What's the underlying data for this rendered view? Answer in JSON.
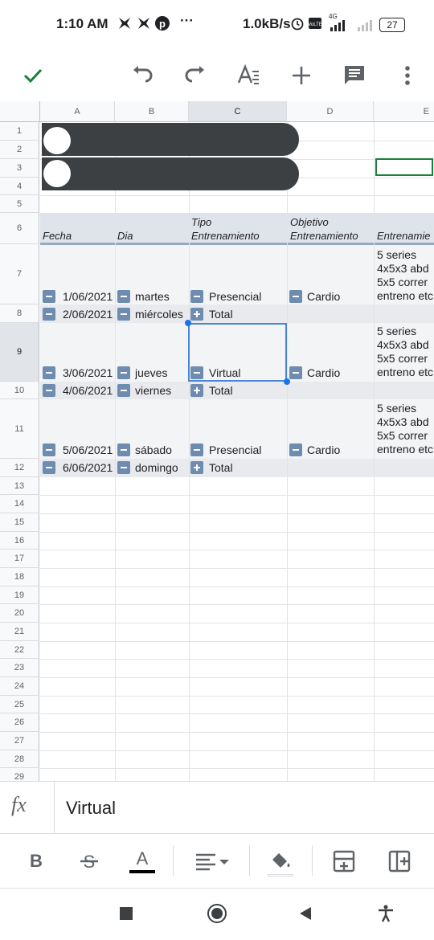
{
  "status_bar": {
    "time": "1:10 AM",
    "more": "···",
    "speed": "1.0kB/s",
    "network": "4G",
    "battery": "27"
  },
  "toolbar": {
    "icons": [
      "check-icon",
      "undo-icon",
      "redo-icon",
      "text-format-icon",
      "add-icon",
      "comment-icon",
      "more-vert-icon"
    ],
    "accent": "#188038"
  },
  "grid": {
    "columns": [
      "A",
      "B",
      "C",
      "D",
      "E"
    ],
    "selected_column": "C",
    "rows": [
      "1",
      "2",
      "3",
      "4",
      "5",
      "6",
      "7",
      "8",
      "9",
      "10",
      "11",
      "12",
      "13",
      "14",
      "15",
      "16",
      "17",
      "18",
      "19",
      "20",
      "21",
      "22",
      "23",
      "24",
      "25",
      "26",
      "27",
      "28",
      "29"
    ],
    "selected_row": "9",
    "headers": {
      "fecha": "Fecha",
      "dia": "Dia",
      "tipo_1": "Tipo",
      "tipo_2": "Entrenamiento",
      "objetivo_1": "Objetivo",
      "objetivo_2": "Entrenamiento",
      "entrenamiento": "Entrenamie"
    },
    "data_rows": [
      {
        "row": "7",
        "fecha": "1/06/2021",
        "dia": "martes",
        "tipo": "Presencial",
        "tipo_toggle": "minus",
        "objetivo": "Cardio",
        "entreno": [
          "5 series",
          "4x5x3 abd",
          "5x5 correr",
          "entreno etc"
        ]
      },
      {
        "row": "8",
        "fecha": "2/06/2021",
        "dia": "miércoles",
        "tipo": "Total",
        "tipo_toggle": "plus"
      },
      {
        "row": "9",
        "fecha": "3/06/2021",
        "dia": "jueves",
        "tipo": "Virtual",
        "tipo_toggle": "minus",
        "objetivo": "Cardio",
        "entreno": [
          "5 series",
          "4x5x3 abd",
          "5x5 correr",
          "entreno etc"
        ]
      },
      {
        "row": "10",
        "fecha": "4/06/2021",
        "dia": "viernes",
        "tipo": "Total",
        "tipo_toggle": "plus"
      },
      {
        "row": "11",
        "fecha": "5/06/2021",
        "dia": "sábado",
        "tipo": "Presencial",
        "tipo_toggle": "minus",
        "objetivo": "Cardio",
        "entreno": [
          "5 series",
          "4x5x3 abd",
          "5x5 correr",
          "entreno etc"
        ]
      },
      {
        "row": "12",
        "fecha": "6/06/2021",
        "dia": "domingo",
        "tipo": "Total",
        "tipo_toggle": "plus"
      }
    ],
    "header_band_color": "#dfe3ea",
    "even_band_color": "#f3f4f6",
    "total_band_color": "#e8eaee",
    "selection_color": "#1a73e8",
    "cursor_cell_color": "#188038"
  },
  "formula_bar": {
    "fx_label": "fx",
    "value": "Virtual"
  },
  "format_bar": {
    "icons": [
      "bold-icon",
      "strikethrough-icon",
      "text-color-icon",
      "align-icon",
      "fill-color-icon",
      "insert-row-icon",
      "insert-column-icon"
    ],
    "bold": "B",
    "text_color": "A"
  },
  "nav_bar": {
    "icons": [
      "recents-icon",
      "home-icon",
      "back-icon",
      "accessibility-icon"
    ]
  }
}
